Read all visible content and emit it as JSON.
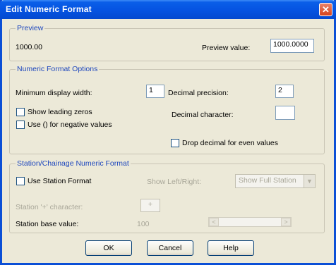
{
  "window": {
    "title": "Edit Numeric Format",
    "close_symbol": "✕"
  },
  "preview": {
    "group_label": "Preview",
    "sample": "1000.00",
    "preview_value_label": "Preview value:",
    "preview_value": "1000.0000"
  },
  "numeric": {
    "group_label": "Numeric Format Options",
    "min_width_label": "Minimum display width:",
    "min_width_value": "1",
    "decimal_precision_label": "Decimal precision:",
    "decimal_precision_value": "2",
    "show_leading_zeros_label": "Show leading zeros",
    "decimal_character_label": "Decimal character:",
    "decimal_character_value": "",
    "use_parens_label": "Use () for negative values",
    "drop_decimal_label": "Drop decimal for even values"
  },
  "station": {
    "group_label": "Station/Chainage Numeric Format",
    "use_station_label": "Use Station Format",
    "show_left_right_label": "Show Left/Right:",
    "show_full_station_option": "Show Full Station",
    "plus_char_label": "Station '+' character:",
    "plus_char_value": "+",
    "base_value_label": "Station base value:",
    "base_value": "100"
  },
  "buttons": {
    "ok": "OK",
    "cancel": "Cancel",
    "help": "Help"
  }
}
